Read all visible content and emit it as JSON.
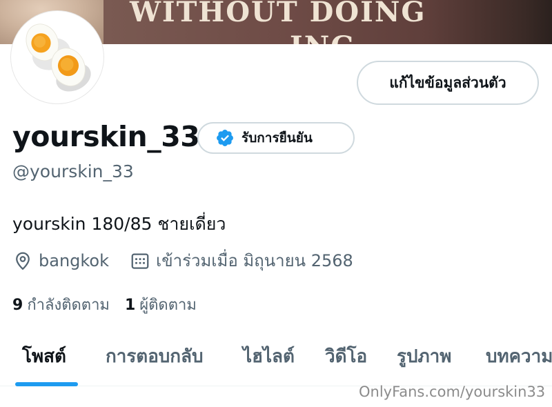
{
  "banner": {
    "book_text_line1": "WITHOUT DOING",
    "book_text_line2": "ING"
  },
  "profile": {
    "avatar_icon": "boiled-egg-halves",
    "edit_button_label": "แก้ไขข้อมูลส่วนตัว",
    "display_name": "yourskin_33",
    "verify_label": "รับการยืนยัน",
    "verify_icon": "verified-badge-icon",
    "handle": "@yourskin_33",
    "bio": "yourskin 180/85 ชายเดี่ยว",
    "location": "bangkok",
    "joined": "เข้าร่วมเมื่อ มิถุนายน 2568",
    "following_count": "9",
    "following_label": "กำลังติดตาม",
    "followers_count": "1",
    "followers_label": "ผู้ติดตาม"
  },
  "tabs": [
    {
      "label": "โพสต์",
      "active": true
    },
    {
      "label": "การตอบกลับ",
      "active": false
    },
    {
      "label": "ไฮไลต์",
      "active": false
    },
    {
      "label": "วิดีโอ",
      "active": false
    },
    {
      "label": "รูปภาพ",
      "active": false
    },
    {
      "label": "บทความ",
      "active": false
    }
  ],
  "watermark": "OnlyFans.com/yourskin33",
  "colors": {
    "accent": "#1d9bf0",
    "text_primary": "#0f1419",
    "text_secondary": "#536471",
    "border": "#cfd9de"
  }
}
